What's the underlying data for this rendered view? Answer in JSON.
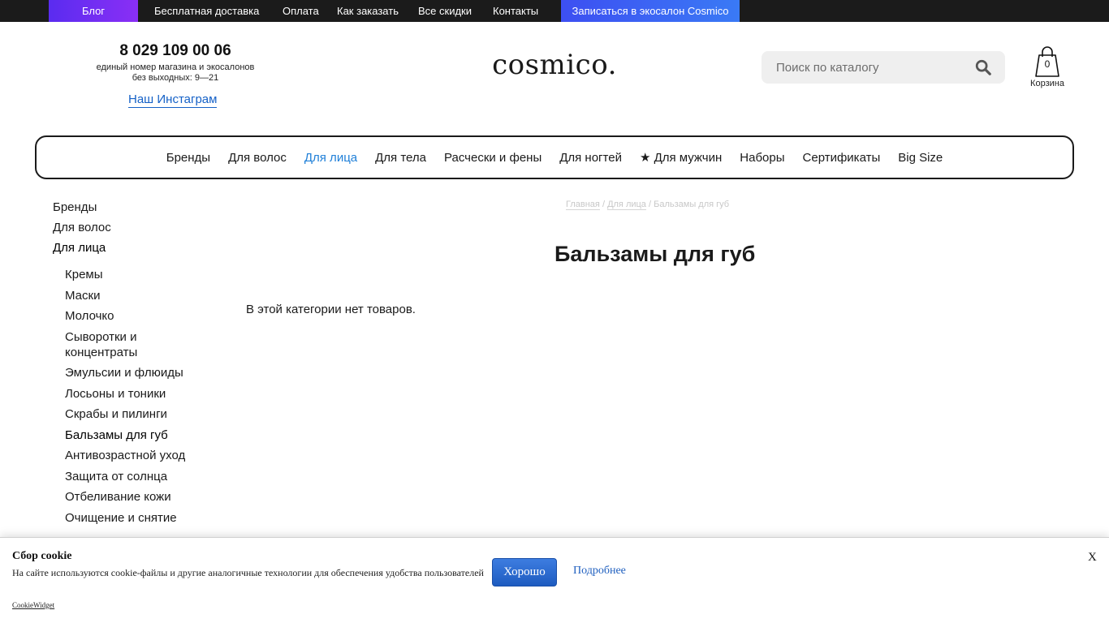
{
  "topbar": {
    "blog": "Блог",
    "links": [
      "Бесплатная доставка",
      "Оплата",
      "Как заказать",
      "Все скидки",
      "Контакты"
    ],
    "salon": "Записаться в экосалон Cosmico"
  },
  "header": {
    "phone": "8 029 109 00 06",
    "phone_note_1": "единый номер магазина и экосалонов",
    "phone_note_2": "без выходных: 9—21",
    "instagram": "Наш Инстаграм",
    "logo": "cosmico.",
    "search_placeholder": "Поиск по каталогу",
    "cart_count": "0",
    "cart_label": "Корзина"
  },
  "nav": {
    "items": [
      "Бренды",
      "Для волос",
      "Для лица",
      "Для тела",
      "Расчески и фены",
      "Для ногтей",
      "★ Для мужчин",
      "Наборы",
      "Сертификаты",
      "Big Size"
    ],
    "active_index": 2
  },
  "sidebar": {
    "top": [
      "Бренды",
      "Для волос",
      "Для лица"
    ],
    "sub": [
      "Кремы",
      "Маски",
      "Молочко",
      "Сыворотки и концентраты",
      "Эмульсии и флюиды",
      "Лосьоны и тоники",
      "Скрабы и пилинги",
      "Бальзамы для губ",
      "Антивозрастной уход",
      "Защита от солнца",
      "Отбеливание кожи",
      "Очищение и снятие"
    ]
  },
  "breadcrumb": {
    "home": "Главная",
    "section": "Для лица",
    "current": "Бальзамы для губ",
    "separator": "/"
  },
  "content": {
    "title": "Бальзамы для губ",
    "empty": "В этой категории нет товаров."
  },
  "cookie": {
    "title": "Сбор cookie",
    "text": "На сайте используются cookie-файлы и другие аналогичные технологии для обеспечения удобства пользователей",
    "ok": "Хорошо",
    "more": "Подробнее",
    "close": "X",
    "widget": "CookieWidget"
  },
  "colors": {
    "topbar_bg": "#1b1b1b",
    "accent_blue": "#1e7fd8",
    "link_blue": "#1561c7"
  }
}
